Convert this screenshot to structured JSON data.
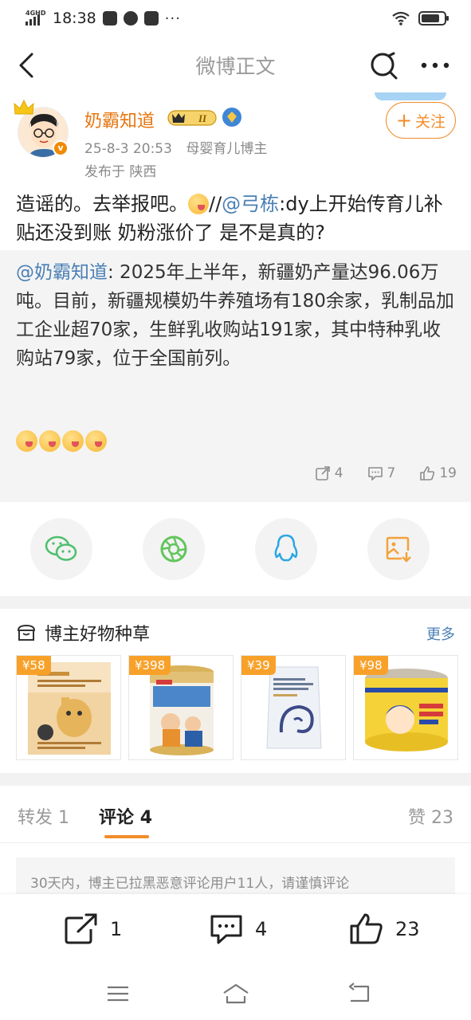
{
  "status_bar": {
    "network": "4GHD",
    "time": "18:38",
    "dots": "···"
  },
  "nav": {
    "title": "微博正文"
  },
  "author": {
    "name": "奶霸知道",
    "level": "II",
    "follow_label": "关注",
    "time": "25-8-3 20:53",
    "category": "母婴育儿博主",
    "location": "发布于 陕西"
  },
  "post": {
    "text_a": "造谣的。去举报吧。",
    "text_b": "//",
    "mention": "@弓栋",
    "text_c": ":dy上开始传育儿补贴还没到账 奶粉涨价了 是不是真的?"
  },
  "repost": {
    "mention": "@奶霸知道",
    "text": ": 2025年上半年，新疆奶产量达96.06万吨。目前，新疆规模奶牛养殖场有180余家，乳制品加工企业超70家，生鲜乳收购站191家，其中特种乳收购站79家，位于全国前列。",
    "share_count": "4",
    "comment_count": "7",
    "like_count": "19"
  },
  "share_targets": [
    "wechat-icon",
    "moments-icon",
    "qq-icon",
    "save-image-icon"
  ],
  "goods": {
    "title": "博主好物种草",
    "more": "更多",
    "items": [
      {
        "price": "¥58"
      },
      {
        "price": "¥398"
      },
      {
        "price": "¥39"
      },
      {
        "price": "¥98"
      }
    ]
  },
  "tabs": {
    "repost": "转发 1",
    "comment_label": "评论",
    "comment_count": "4",
    "like": "赞 23"
  },
  "notice": "30天内，博主已拉黑恶意评论用户11人，请谨慎评论",
  "actions": {
    "repost": "1",
    "comment": "4",
    "like": "23"
  },
  "colors": {
    "accent": "#f28c2a",
    "link": "#4a7fb5",
    "name": "#e8750e"
  }
}
